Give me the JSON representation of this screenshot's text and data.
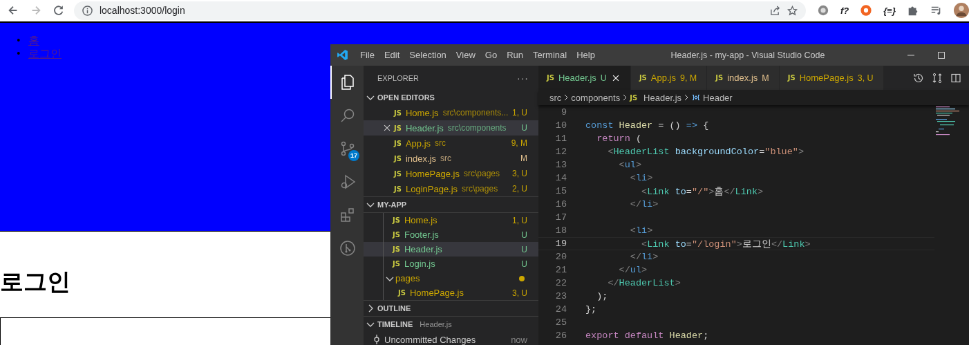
{
  "browser": {
    "url": "localhost:3000/login",
    "back_disabled": false,
    "forward_disabled": true,
    "extensions": [
      {
        "kind": "gear"
      },
      {
        "kind": "text",
        "text": "f?"
      },
      {
        "kind": "lifebuoy"
      },
      {
        "kind": "text",
        "text": "{≡}"
      },
      {
        "kind": "puzzle"
      },
      {
        "kind": "playlist"
      },
      {
        "kind": "avatar"
      }
    ]
  },
  "page": {
    "nav_links": [
      {
        "marker": "•",
        "label": "홈"
      },
      {
        "marker": "•",
        "label": "로그인"
      }
    ],
    "heading": "로그인"
  },
  "vscode": {
    "menu": [
      "File",
      "Edit",
      "Selection",
      "View",
      "Go",
      "Run",
      "Terminal",
      "Help"
    ],
    "title": "Header.js - my-app - Visual Studio Code",
    "activity": [
      {
        "kind": "files",
        "selected": true
      },
      {
        "kind": "search",
        "selected": false
      },
      {
        "kind": "source-control",
        "selected": false,
        "badge": "17"
      },
      {
        "kind": "run",
        "selected": false
      },
      {
        "kind": "extensions",
        "selected": false
      },
      {
        "kind": "graph",
        "selected": false
      }
    ],
    "explorer": {
      "title": "EXPLORER",
      "more": "···",
      "open_editors": {
        "title": "OPEN EDITORS",
        "expanded": true,
        "items": [
          {
            "icon": "JS",
            "name": "Home.js",
            "path": "src\\components...",
            "badge": "1, U",
            "color": "#cca700",
            "selected": false
          },
          {
            "icon": "JS",
            "name": "Header.js",
            "path": "src\\components",
            "badge": "U",
            "color": "#73c991",
            "selected": true
          },
          {
            "icon": "JS",
            "name": "App.js",
            "path": "src",
            "badge": "9, M",
            "color": "#cca700",
            "selected": false
          },
          {
            "icon": "JS",
            "name": "index.js",
            "path": "src",
            "badge": "M",
            "color": "#e2c08d",
            "selected": false
          },
          {
            "icon": "JS",
            "name": "HomePage.js",
            "path": "src\\pages",
            "badge": "3, U",
            "color": "#cca700",
            "selected": false
          },
          {
            "icon": "JS",
            "name": "LoginPage.js",
            "path": "src\\pages",
            "badge": "2, U",
            "color": "#cca700",
            "selected": false
          }
        ]
      },
      "project": {
        "title": "MY-APP",
        "expanded": true,
        "items": [
          {
            "icon": "JS",
            "name": "Home.js",
            "badge": "1, U",
            "color": "#cca700",
            "selected": false
          },
          {
            "icon": "JS",
            "name": "Footer.js",
            "badge": "U",
            "color": "#73c991",
            "selected": false
          },
          {
            "icon": "JS",
            "name": "Header.js",
            "badge": "U",
            "color": "#73c991",
            "selected": true
          },
          {
            "icon": "JS",
            "name": "Login.js",
            "badge": "U",
            "color": "#73c991",
            "selected": false
          },
          {
            "kind": "folder",
            "name": "pages",
            "expanded": true,
            "color": "#cca700",
            "selected": false,
            "children": [
              {
                "icon": "JS",
                "name": "HomePage.js",
                "badge": "3, U",
                "color": "#cca700",
                "selected": false
              }
            ]
          }
        ]
      },
      "outline": {
        "title": "OUTLINE",
        "expanded": false
      },
      "timeline": {
        "title": "TIMELINE",
        "file": "Header.js",
        "expanded": true,
        "items": [
          {
            "label": "Uncommitted Changes",
            "time": "now"
          }
        ]
      }
    },
    "tabs": [
      {
        "icon": "JS",
        "name": "Header.js",
        "badge": "U",
        "color": "#73c991",
        "selected": true
      },
      {
        "icon": "JS",
        "name": "App.js",
        "badge": "9, M",
        "color": "#cca700",
        "selected": false
      },
      {
        "icon": "JS",
        "name": "index.js",
        "badge": "M",
        "color": "#e2c08d",
        "selected": false
      },
      {
        "icon": "JS",
        "name": "HomePage.js",
        "badge": "3, U",
        "color": "#cca700",
        "selected": false
      }
    ],
    "breadcrumbs": [
      {
        "kind": "folder",
        "text": "src"
      },
      {
        "kind": "folder",
        "text": "components"
      },
      {
        "kind": "file",
        "icon": "JS",
        "text": "Header.js"
      },
      {
        "kind": "symbol",
        "text": "Header"
      }
    ],
    "code": [
      {
        "number": "9",
        "current": false
      },
      {
        "number": "10",
        "current": false,
        "tokens": [
          {
            "text": "const ",
            "kind": "kw"
          },
          {
            "text": "Header",
            "kind": "fn"
          },
          {
            "text": " = () ",
            "kind": "plain"
          },
          {
            "text": "=>",
            "kind": "kw"
          },
          {
            "text": " {",
            "kind": "plain"
          }
        ]
      },
      {
        "number": "11",
        "current": false,
        "tokens": [
          {
            "text": "  return",
            "kind": "ctl"
          },
          {
            "text": " (",
            "kind": "plain"
          }
        ]
      },
      {
        "number": "12",
        "current": false,
        "tokens": [
          {
            "text": "    <",
            "kind": "punct"
          },
          {
            "text": "HeaderList ",
            "kind": "comp"
          },
          {
            "text": "backgroundColor",
            "kind": "attr"
          },
          {
            "text": "=",
            "kind": "plain"
          },
          {
            "text": "\"blue\"",
            "kind": "str"
          },
          {
            "text": ">",
            "kind": "punct"
          }
        ]
      },
      {
        "number": "13",
        "current": false,
        "tokens": [
          {
            "text": "      <",
            "kind": "punct"
          },
          {
            "text": "ul",
            "kind": "kw"
          },
          {
            "text": ">",
            "kind": "punct"
          }
        ]
      },
      {
        "number": "14",
        "current": false,
        "tokens": [
          {
            "text": "        <",
            "kind": "punct"
          },
          {
            "text": "li",
            "kind": "kw"
          },
          {
            "text": ">",
            "kind": "punct"
          }
        ]
      },
      {
        "number": "15",
        "current": false,
        "tokens": [
          {
            "text": "          <",
            "kind": "punct"
          },
          {
            "text": "Link ",
            "kind": "comp"
          },
          {
            "text": "to",
            "kind": "attr"
          },
          {
            "text": "=",
            "kind": "plain"
          },
          {
            "text": "\"/\"",
            "kind": "str"
          },
          {
            "text": ">",
            "kind": "punct"
          },
          {
            "text": "홈",
            "kind": "plain"
          },
          {
            "text": "</",
            "kind": "punct"
          },
          {
            "text": "Link",
            "kind": "comp"
          },
          {
            "text": ">",
            "kind": "punct"
          }
        ]
      },
      {
        "number": "16",
        "current": false,
        "tokens": [
          {
            "text": "        </",
            "kind": "punct"
          },
          {
            "text": "li",
            "kind": "kw"
          },
          {
            "text": ">",
            "kind": "punct"
          }
        ]
      },
      {
        "number": "17",
        "current": false
      },
      {
        "number": "18",
        "current": false,
        "tokens": [
          {
            "text": "        <",
            "kind": "punct"
          },
          {
            "text": "li",
            "kind": "kw"
          },
          {
            "text": ">",
            "kind": "punct"
          }
        ]
      },
      {
        "number": "19",
        "current": true,
        "tokens": [
          {
            "text": "          <",
            "kind": "punct"
          },
          {
            "text": "Link ",
            "kind": "comp"
          },
          {
            "text": "to",
            "kind": "attr"
          },
          {
            "text": "=",
            "kind": "plain"
          },
          {
            "text": "\"/login\"",
            "kind": "str"
          },
          {
            "text": ">",
            "kind": "punct"
          },
          {
            "text": "로그인",
            "kind": "plain"
          },
          {
            "text": "</",
            "kind": "punct"
          },
          {
            "text": "Link",
            "kind": "comp"
          },
          {
            "text": ">",
            "kind": "punct"
          }
        ]
      },
      {
        "number": "20",
        "current": false,
        "tokens": [
          {
            "text": "        </",
            "kind": "punct"
          },
          {
            "text": "li",
            "kind": "kw"
          },
          {
            "text": ">",
            "kind": "punct"
          }
        ]
      },
      {
        "number": "21",
        "current": false,
        "tokens": [
          {
            "text": "      </",
            "kind": "punct"
          },
          {
            "text": "ul",
            "kind": "kw"
          },
          {
            "text": ">",
            "kind": "punct"
          }
        ]
      },
      {
        "number": "22",
        "current": false,
        "tokens": [
          {
            "text": "    </",
            "kind": "punct"
          },
          {
            "text": "HeaderList",
            "kind": "comp"
          },
          {
            "text": ">",
            "kind": "punct"
          }
        ]
      },
      {
        "number": "23",
        "current": false,
        "tokens": [
          {
            "text": "  );",
            "kind": "plain"
          }
        ]
      },
      {
        "number": "24",
        "current": false,
        "tokens": [
          {
            "text": "};",
            "kind": "plain"
          }
        ]
      },
      {
        "number": "25",
        "current": false
      },
      {
        "number": "26",
        "current": false,
        "tokens": [
          {
            "text": "export default ",
            "kind": "ctl"
          },
          {
            "text": "Header",
            "kind": "fn"
          },
          {
            "text": ";",
            "kind": "plain"
          }
        ]
      }
    ]
  }
}
